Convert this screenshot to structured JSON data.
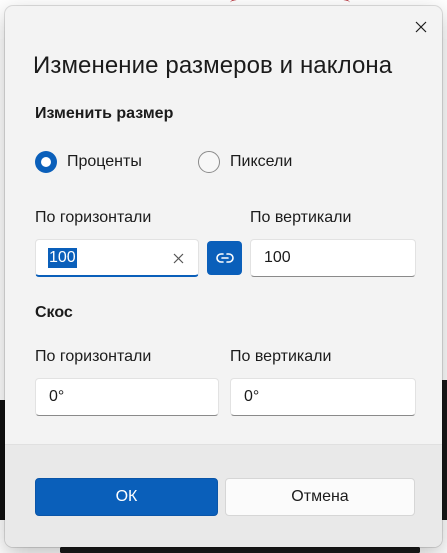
{
  "dialog": {
    "title": "Изменение размеров и наклона",
    "close_icon": "close-icon"
  },
  "resize": {
    "heading": "Изменить размер",
    "options": [
      {
        "label": "Проценты",
        "selected": true
      },
      {
        "label": "Пиксели",
        "selected": false
      }
    ],
    "horizontal_label": "По горизонтали",
    "vertical_label": "По вертикали",
    "horizontal_value": "100",
    "vertical_value": "100",
    "link_icon": "link-icon"
  },
  "skew": {
    "heading": "Скос",
    "horizontal_label": "По горизонтали",
    "vertical_label": "По вертикали",
    "horizontal_value": "0°",
    "vertical_value": "0°"
  },
  "footer": {
    "ok_label": "ОК",
    "cancel_label": "Отмена"
  },
  "colors": {
    "accent": "#0a5fba",
    "dialog_bg": "#f3f3f3",
    "footer_bg": "#e9e9e9"
  }
}
